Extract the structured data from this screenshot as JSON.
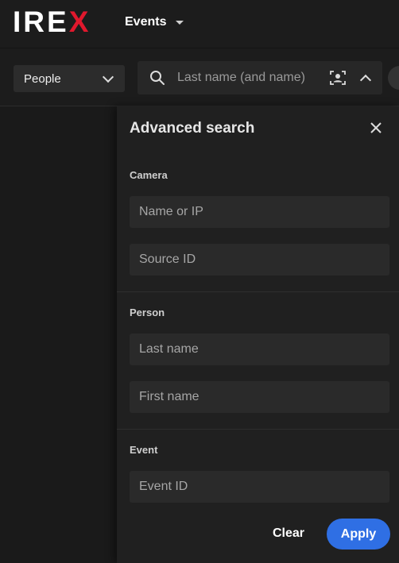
{
  "header": {
    "logo_text": "IREX",
    "nav_label": "Events"
  },
  "filter": {
    "type_select": "People",
    "search_placeholder": "Last name (and name)"
  },
  "advanced_search": {
    "title": "Advanced search",
    "sections": {
      "camera": {
        "label": "Camera",
        "name_placeholder": "Name or IP",
        "source_placeholder": "Source ID"
      },
      "person": {
        "label": "Person",
        "last_name_placeholder": "Last name",
        "first_name_placeholder": "First name"
      },
      "event": {
        "label": "Event",
        "event_id_placeholder": "Event ID"
      }
    },
    "clear_label": "Clear",
    "apply_label": "Apply"
  },
  "colors": {
    "background": "#1a1a1a",
    "panel": "#202020",
    "field": "#2a2a2a",
    "accent": "#2f6fe4",
    "logo_accent": "#e0182d"
  }
}
